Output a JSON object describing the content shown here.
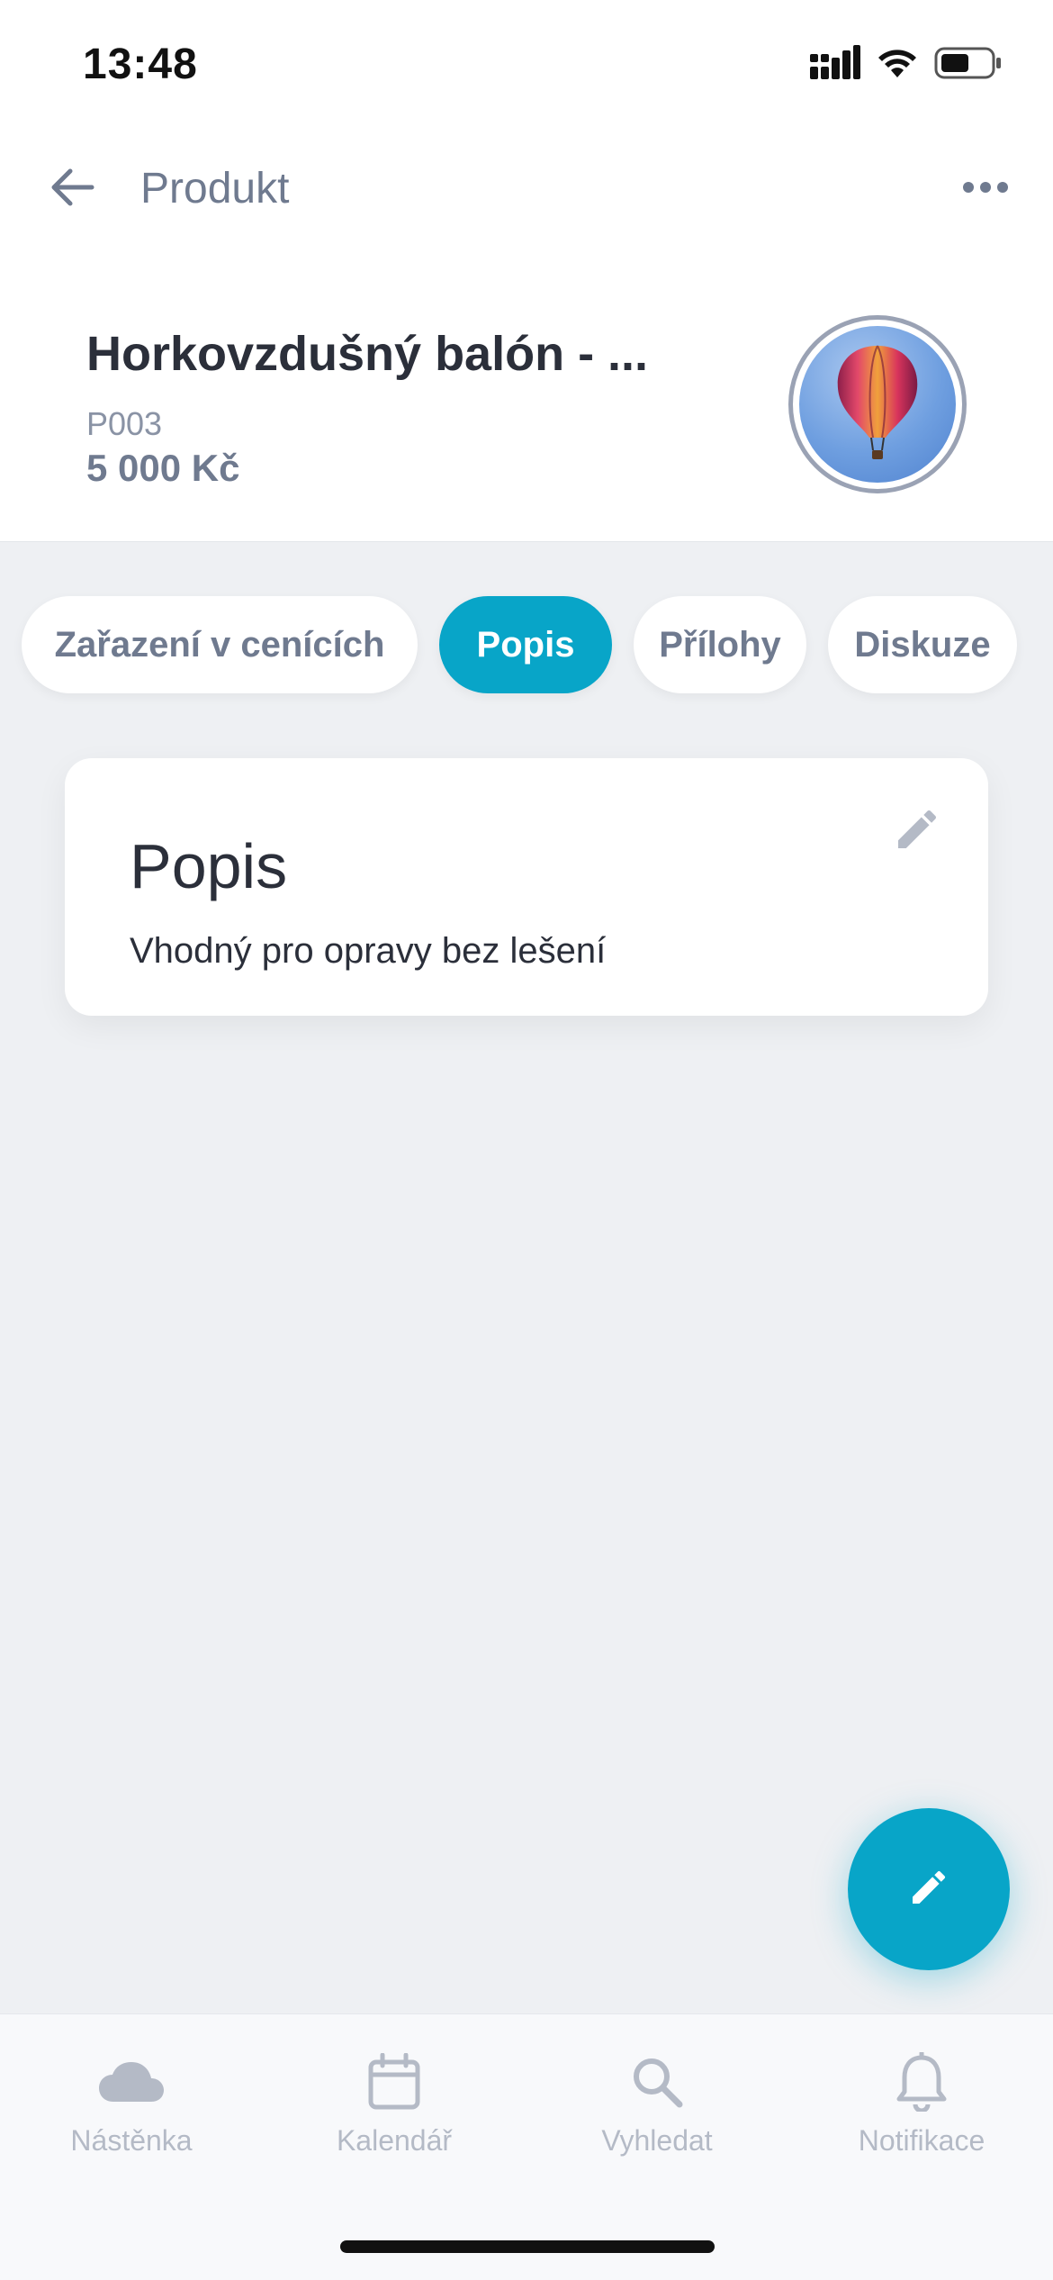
{
  "status_bar": {
    "time": "13:48"
  },
  "header": {
    "title": "Produkt",
    "back_icon": "arrow-left-icon",
    "more_icon": "more-horizontal-icon"
  },
  "product": {
    "name": "Horkovzdušný balón - ...",
    "code": "P003",
    "price": "5 000 Kč",
    "image_icon": "hot-air-balloon-image"
  },
  "tabs": [
    {
      "label": "Zařazení v cenících",
      "active": false
    },
    {
      "label": "Popis",
      "active": true
    },
    {
      "label": "Přílohy",
      "active": false
    },
    {
      "label": "Diskuze",
      "active": false
    }
  ],
  "card": {
    "title": "Popis",
    "text": "Vhodný pro opravy bez lešení",
    "edit_icon": "pencil-icon"
  },
  "fab": {
    "icon": "pencil-icon"
  },
  "bottom_nav": [
    {
      "label": "Nástěnka",
      "icon": "cloud-icon"
    },
    {
      "label": "Kalendář",
      "icon": "calendar-icon"
    },
    {
      "label": "Vyhledat",
      "icon": "search-icon"
    },
    {
      "label": "Notifikace",
      "icon": "bell-icon"
    }
  ],
  "colors": {
    "accent": "#08a5c8",
    "muted_text": "#6f7a8f",
    "nav_inactive": "#b4bac6",
    "background": "#eef0f3"
  }
}
